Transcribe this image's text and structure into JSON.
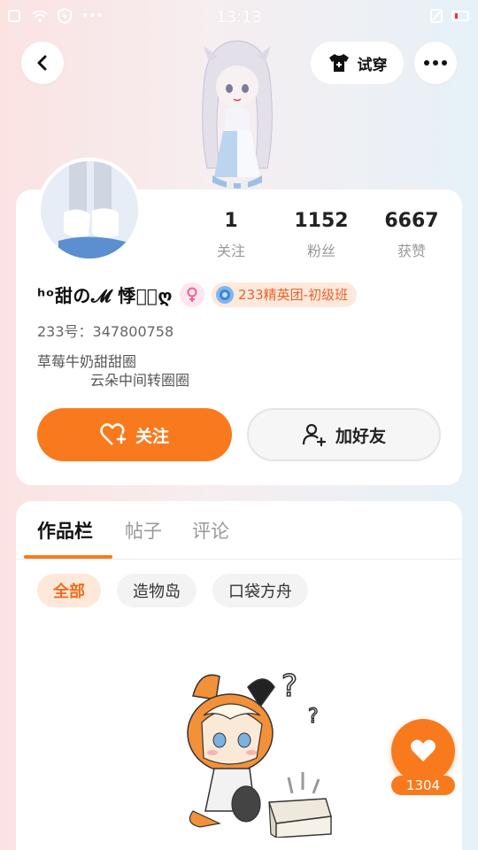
{
  "status_bar": {
    "time": "13:13",
    "battery_level": "7"
  },
  "header": {
    "tryon_label": "试穿"
  },
  "profile": {
    "name": "ʰᵒ甜の𝓜 悸念⃢ღ",
    "uid": "233号：347800758",
    "bio_line1": "草莓牛奶甜甜圈",
    "bio_line2": "云朵中间转圈圈",
    "rank_badge": "233精英团-初级班",
    "stats": [
      {
        "num": "1",
        "label": "关注"
      },
      {
        "num": "1152",
        "label": "粉丝"
      },
      {
        "num": "6667",
        "label": "获赞"
      }
    ],
    "follow_label": "关注",
    "add_friend_label": "加好友"
  },
  "works": {
    "tabs": [
      {
        "label": "作品栏",
        "active": true
      },
      {
        "label": "帖子",
        "active": false
      },
      {
        "label": "评论",
        "active": false
      }
    ],
    "filters": [
      {
        "label": "全部",
        "active": true
      },
      {
        "label": "造物岛",
        "active": false
      },
      {
        "label": "口袋方舟",
        "active": false
      }
    ]
  },
  "like": {
    "count": "1304"
  },
  "colors": {
    "accent": "#f97a1c",
    "accent_light": "#fde8da"
  },
  "icons": [
    "back-icon",
    "tshirt-icon",
    "more-icon",
    "heart-plus-icon",
    "add-user-icon",
    "heart-icon",
    "female-icon",
    "rank-gem-icon"
  ]
}
